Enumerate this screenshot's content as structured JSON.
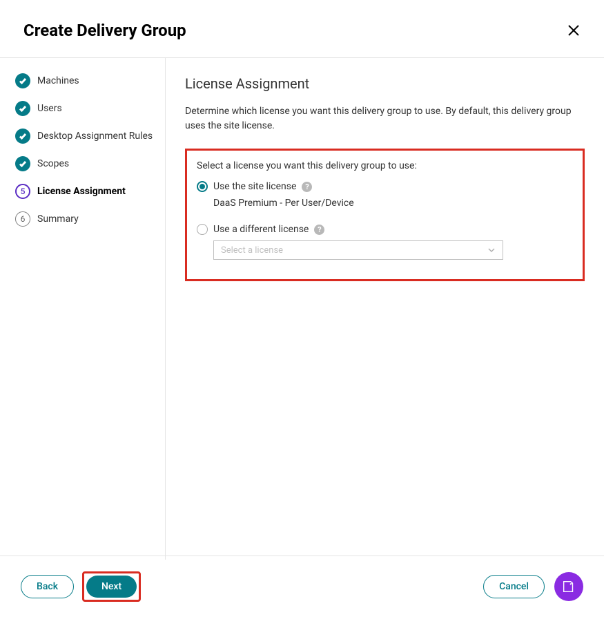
{
  "header": {
    "title": "Create Delivery Group"
  },
  "sidebar": {
    "steps": [
      {
        "label": "Machines"
      },
      {
        "label": "Users"
      },
      {
        "label": "Desktop Assignment Rules"
      },
      {
        "label": "Scopes"
      },
      {
        "number": "5",
        "label": "License Assignment"
      },
      {
        "number": "6",
        "label": "Summary"
      }
    ]
  },
  "main": {
    "title": "License Assignment",
    "description": "Determine which license you want this delivery group to use. By default, this delivery group uses the site license.",
    "section_label": "Select a license you want this delivery group to use:",
    "option_site": "Use the site license",
    "site_license_detail": "DaaS Premium - Per User/Device",
    "option_different": "Use a different license",
    "select_placeholder": "Select a license"
  },
  "footer": {
    "back": "Back",
    "next": "Next",
    "cancel": "Cancel"
  }
}
